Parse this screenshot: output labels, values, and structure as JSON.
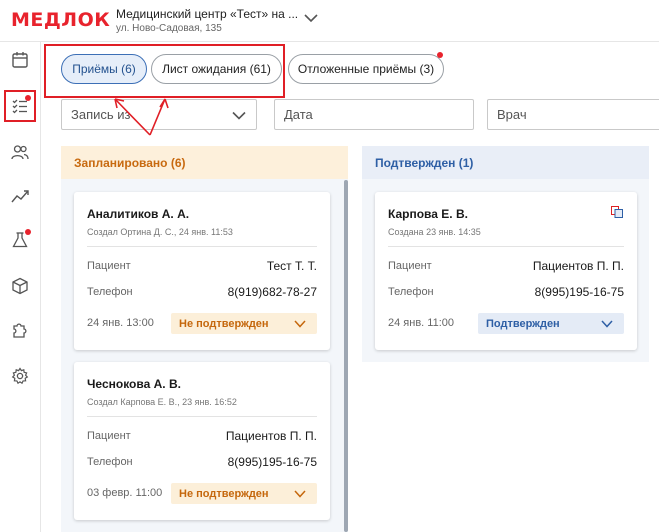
{
  "header": {
    "logo": "МЕДЛОК",
    "clinic_name": "Медицинский центр «Тест» на ...",
    "clinic_address": "ул. Ново-Садовая, 135"
  },
  "sidebar": {
    "items": [
      {
        "icon": "calendar-icon",
        "active": false,
        "badge": false
      },
      {
        "icon": "task-list-icon",
        "active": true,
        "badge": true
      },
      {
        "icon": "users-icon",
        "active": false,
        "badge": false
      },
      {
        "icon": "chart-icon",
        "active": false,
        "badge": false
      },
      {
        "icon": "flask-icon",
        "active": false,
        "badge": true
      },
      {
        "icon": "box-icon",
        "active": false,
        "badge": false
      },
      {
        "icon": "puzzle-icon",
        "active": false,
        "badge": false
      },
      {
        "icon": "gear-icon",
        "active": false,
        "badge": false
      }
    ]
  },
  "tabs": [
    {
      "label": "Приёмы (6)",
      "active": true
    },
    {
      "label": "Лист ожидания (61)",
      "active": false
    },
    {
      "label": "Отложенные приёмы (3)",
      "active": false,
      "badge": true
    }
  ],
  "filters": {
    "source": "Запись из",
    "date": "Дата",
    "doctor": "Врач"
  },
  "columns": {
    "planned": {
      "title": "Запланировано (6)",
      "cards": [
        {
          "name": "Аналитиков А. А.",
          "meta": "Создал Ортина Д. С., 24 янв. 11:53",
          "patient_label": "Пациент",
          "patient": "Тест Т. Т.",
          "phone_label": "Телефон",
          "phone": "8(919)682-78-27",
          "time": "24 янв. 13:00",
          "status": "Не подтвержден"
        },
        {
          "name": "Чеснокова А. В.",
          "meta": "Создал Карпова Е. В., 23 янв. 16:52",
          "patient_label": "Пациент",
          "patient": "Пациентов П. П.",
          "phone_label": "Телефон",
          "phone": "8(995)195-16-75",
          "time": "03 февр. 11:00",
          "status": "Не подтвержден"
        }
      ]
    },
    "confirmed": {
      "title": "Подтвержден (1)",
      "cards": [
        {
          "name": "Карпова Е. В.",
          "meta": "Создана 23 янв. 14:35",
          "patient_label": "Пациент",
          "patient": "Пациентов П. П.",
          "phone_label": "Телефон",
          "phone": "8(995)195-16-75",
          "time": "24 янв. 11:00",
          "status": "Подтвержден"
        }
      ]
    }
  },
  "colors": {
    "brand": "#e8232d",
    "annotation": "#e01f26",
    "planned_text": "#c86a10",
    "confirmed_text": "#2e5fa5"
  }
}
